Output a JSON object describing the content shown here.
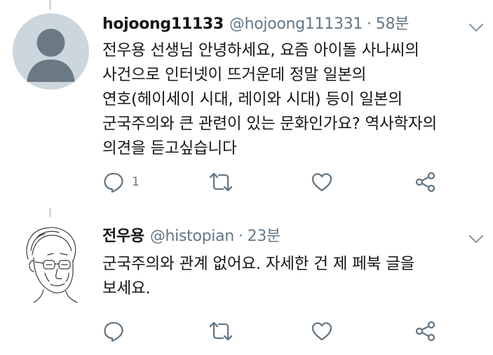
{
  "tweets": [
    {
      "name": "hojoong11133",
      "handle": "@hojoong111331",
      "separator": "·",
      "time": "58분",
      "avatar_icon": "default-user-avatar-icon",
      "lines": [
        "전우용 선생님 안녕하세요, 요즘 아이돌 사나씨의",
        "사건으로 인터넷이 뜨거운데 정말 일본의",
        "연호(헤이세이 시대, 레이와 시대) 등이 일본의",
        "군국주의와 큰 관련이 있는 문화인가요? 역사학자의",
        "의견을 듣고싶습니다"
      ],
      "reply_count": "1"
    },
    {
      "name": "전우용",
      "handle": "@histopian",
      "separator": "·",
      "time": "23분",
      "avatar_icon": "sketch-portrait-avatar-icon",
      "lines": [
        "군국주의와 관계 없어요. 자세한 건 제 페북 글을",
        "보세요."
      ],
      "reply_count": ""
    }
  ],
  "colors": {
    "text": "#14171a",
    "secondary": "#657786",
    "icon": "#657786",
    "thread_line": "#d5dbe0",
    "avatar_bg": "#ccd6dd",
    "avatar_figure": "#6b7985"
  },
  "icons": [
    "chevron-down-icon",
    "reply-icon",
    "retweet-icon",
    "like-icon",
    "share-icon"
  ]
}
